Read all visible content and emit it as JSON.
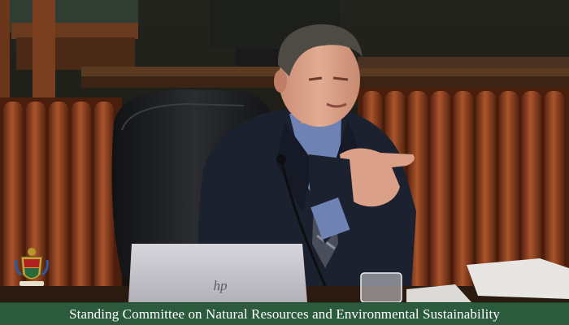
{
  "broadcast": {
    "caption": "Standing Committee on Natural Resources and Environmental Sustainability",
    "crest_icon": "provincial-crest-icon",
    "caption_bar_color": "#2c5a3c"
  },
  "scene": {
    "laptop_logo_text": "hp",
    "colors": {
      "radiator": "#8a3f20",
      "wall": "#1c1b17",
      "suit": "#1c2130",
      "shirt": "#6f82b4",
      "chair": "#1b1c1e",
      "laptop": "#c8c6cc"
    }
  }
}
